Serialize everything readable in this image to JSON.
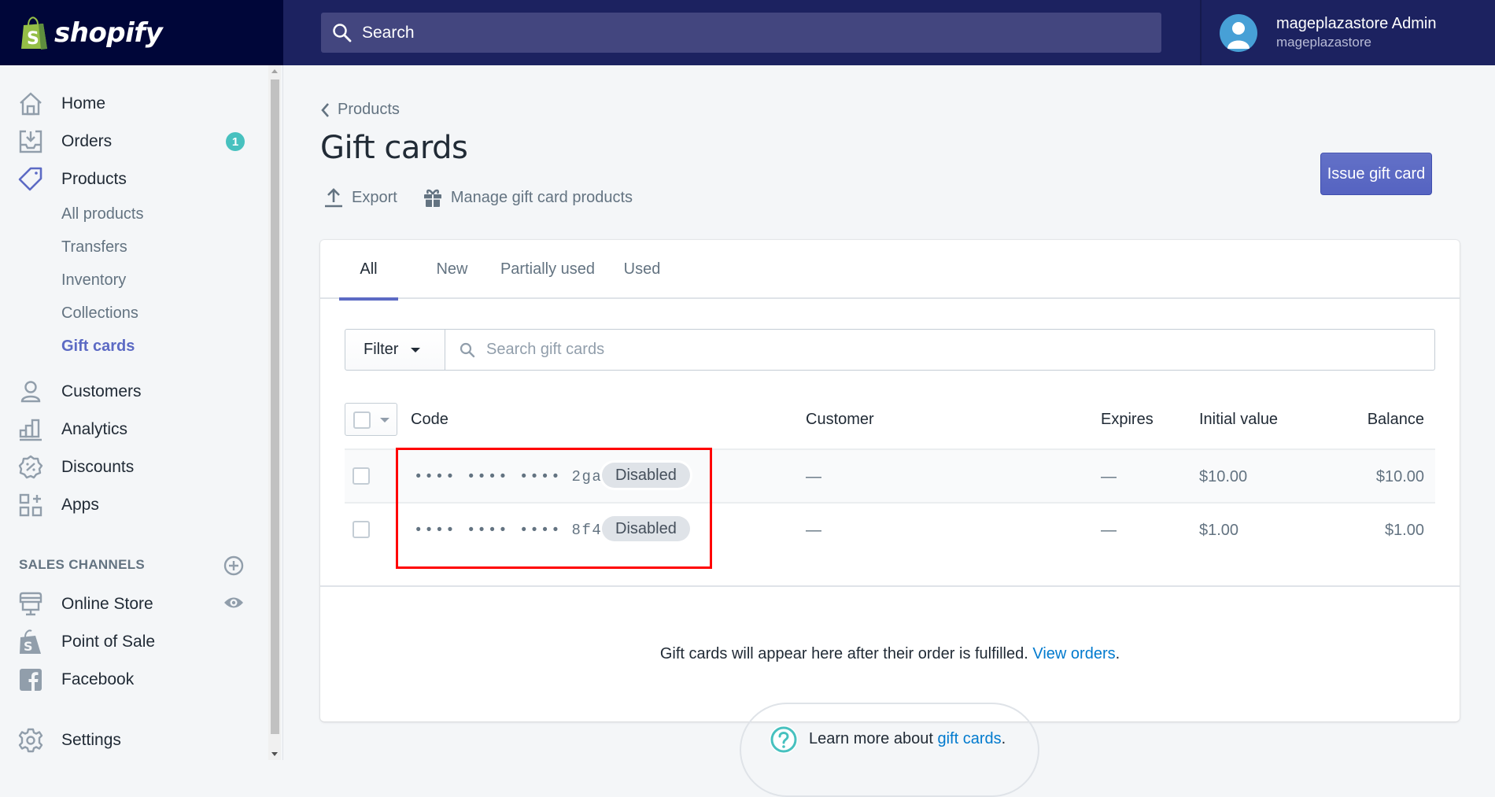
{
  "topbar": {
    "brand": "shopify",
    "search_placeholder": "Search",
    "user": {
      "name": "mageplazastore Admin",
      "store": "mageplazastore"
    }
  },
  "sidebar": {
    "items": [
      {
        "label": "Home",
        "icon": "home-icon"
      },
      {
        "label": "Orders",
        "icon": "orders-icon",
        "badge": "1"
      },
      {
        "label": "Products",
        "icon": "tag-icon",
        "active": true
      },
      {
        "label": "Customers",
        "icon": "person-icon"
      },
      {
        "label": "Analytics",
        "icon": "bar-chart-icon"
      },
      {
        "label": "Discounts",
        "icon": "discount-icon"
      },
      {
        "label": "Apps",
        "icon": "apps-icon"
      }
    ],
    "products_sub": [
      {
        "label": "All products"
      },
      {
        "label": "Transfers"
      },
      {
        "label": "Inventory"
      },
      {
        "label": "Collections"
      },
      {
        "label": "Gift cards",
        "active": true
      }
    ],
    "sales_channels_title": "SALES CHANNELS",
    "channels": [
      {
        "label": "Online Store",
        "icon": "store-icon"
      },
      {
        "label": "Point of Sale",
        "icon": "pos-bag-icon"
      },
      {
        "label": "Facebook",
        "icon": "facebook-icon"
      }
    ],
    "settings": {
      "label": "Settings",
      "icon": "gear-icon"
    }
  },
  "page": {
    "breadcrumb": "Products",
    "title": "Gift cards",
    "actions": {
      "export": "Export",
      "manage": "Manage gift card products"
    },
    "primary_button": "Issue gift card",
    "accent_color": "#5c6ac4"
  },
  "tabs": [
    {
      "label": "All",
      "active": true
    },
    {
      "label": "New"
    },
    {
      "label": "Partially used"
    },
    {
      "label": "Used"
    }
  ],
  "filter": {
    "button_label": "Filter",
    "search_placeholder": "Search gift cards"
  },
  "table": {
    "columns": {
      "code": "Code",
      "customer": "Customer",
      "expires": "Expires",
      "initial_value": "Initial value",
      "balance": "Balance"
    },
    "rows": [
      {
        "code_mask": "•••• •••• ••••",
        "code_suffix": "2ga9",
        "status": "Disabled",
        "customer": "—",
        "expires": "—",
        "initial_value": "$10.00",
        "balance": "$10.00"
      },
      {
        "code_mask": "•••• •••• ••••",
        "code_suffix": "8f44",
        "status": "Disabled",
        "customer": "—",
        "expires": "—",
        "initial_value": "$1.00",
        "balance": "$1.00"
      }
    ]
  },
  "footer_note": {
    "text": "Gift cards will appear here after their order is fulfilled.",
    "link": "View orders",
    "suffix": "."
  },
  "learn_more": {
    "text": "Learn more about",
    "link": "gift cards",
    "suffix": "."
  }
}
